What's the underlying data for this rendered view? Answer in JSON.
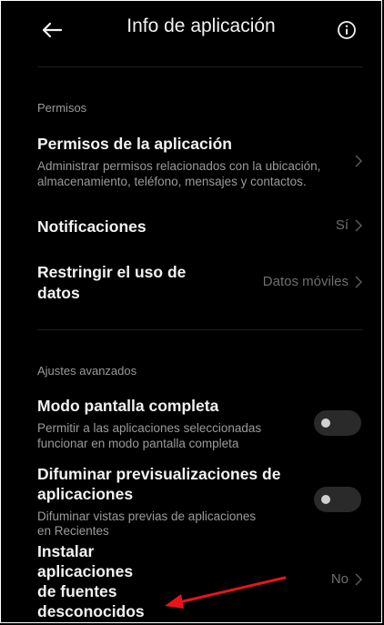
{
  "header": {
    "title": "Info de aplicación",
    "back_icon": "arrow-left-icon",
    "info_icon": "info-circle-icon"
  },
  "sections": {
    "permisos_label": "Permisos",
    "ajustes_label": "Ajustes avanzados"
  },
  "rows": {
    "permisos_app": {
      "title": "Permisos de la aplicación",
      "subtitle_line1": "Administrar permisos relacionados con la ubicación,",
      "subtitle_line2": "almacenamiento, teléfono, mensajes y contactos."
    },
    "notificaciones": {
      "title": "Notificaciones",
      "value": "Sí"
    },
    "restringir": {
      "title_line1": "Restringir el uso de",
      "title_line2": "datos",
      "value": "Datos móviles"
    },
    "pantalla_completa": {
      "title": "Modo pantalla completa",
      "subtitle_line1": "Permitir a las aplicaciones seleccionadas",
      "subtitle_line2": "funcionar en modo pantalla completa",
      "enabled": false
    },
    "difuminar": {
      "title_line1": "Difuminar previsualizaciones de",
      "title_line2": "aplicaciones",
      "subtitle_line1": "Difuminar vistas previas de aplicaciones",
      "subtitle_line2": "en Recientes",
      "enabled": false
    },
    "fuentes": {
      "title_line1": "Instalar",
      "title_line2": "aplicaciones",
      "title_line3": "de fuentes",
      "title_line4": "desconocidos",
      "value": "No"
    }
  },
  "colors": {
    "background": "#000000",
    "annotation_arrow": "#e8141c"
  }
}
